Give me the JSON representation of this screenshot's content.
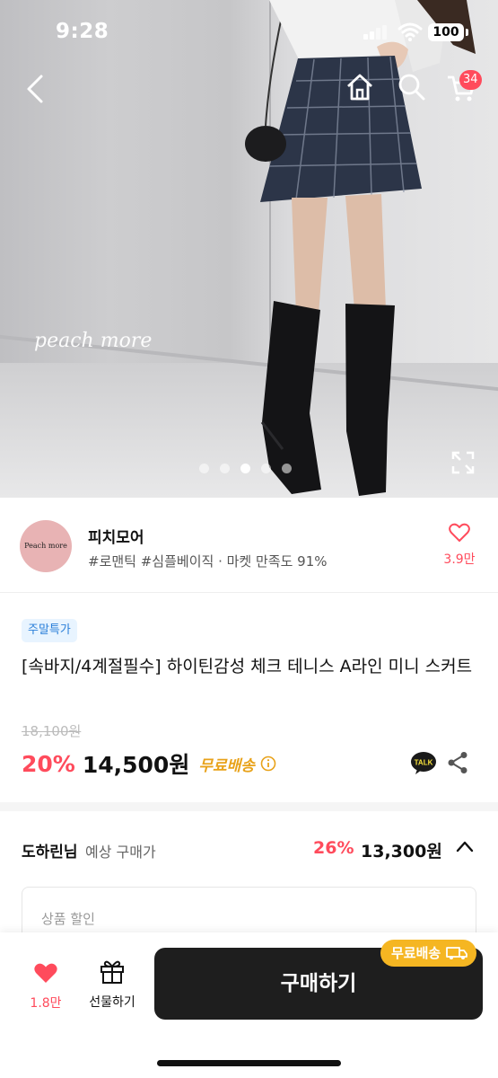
{
  "status_bar": {
    "time": "9:28",
    "battery": "100"
  },
  "header": {
    "cart_count": "34"
  },
  "hero": {
    "watermark": "peach more",
    "slide_count": 5,
    "active_slide": 3
  },
  "shop": {
    "logo_text": "Peach more",
    "name": "피치모어",
    "tags": "#로맨틱 #심플베이직 · 마켓 만족도 91%",
    "likes": "3.9만"
  },
  "product": {
    "badge": "주말특가",
    "title": "[속바지/4계절필수] 하이틴감성 체크 테니스 A라인 미니 스커트",
    "original_price": "18,100원",
    "discount_rate": "20%",
    "price": "14,500원",
    "free_shipping": "무료배송",
    "talk_label": "TALK"
  },
  "expected_price": {
    "user": "도하린님",
    "label": "예상 구매가",
    "rate": "26%",
    "price": "13,300원"
  },
  "discount_box": {
    "label": "상품 할인"
  },
  "bottom_bar": {
    "likes": "1.8만",
    "gift_label": "선물하기",
    "buy_label": "구매하기",
    "ship_tag": "무료배송"
  },
  "colors": {
    "accent": "#ff4b5c",
    "shipping": "#e8a21a",
    "ship_tag_bg": "#f5b622",
    "buy_button": "#1e1e1e"
  }
}
